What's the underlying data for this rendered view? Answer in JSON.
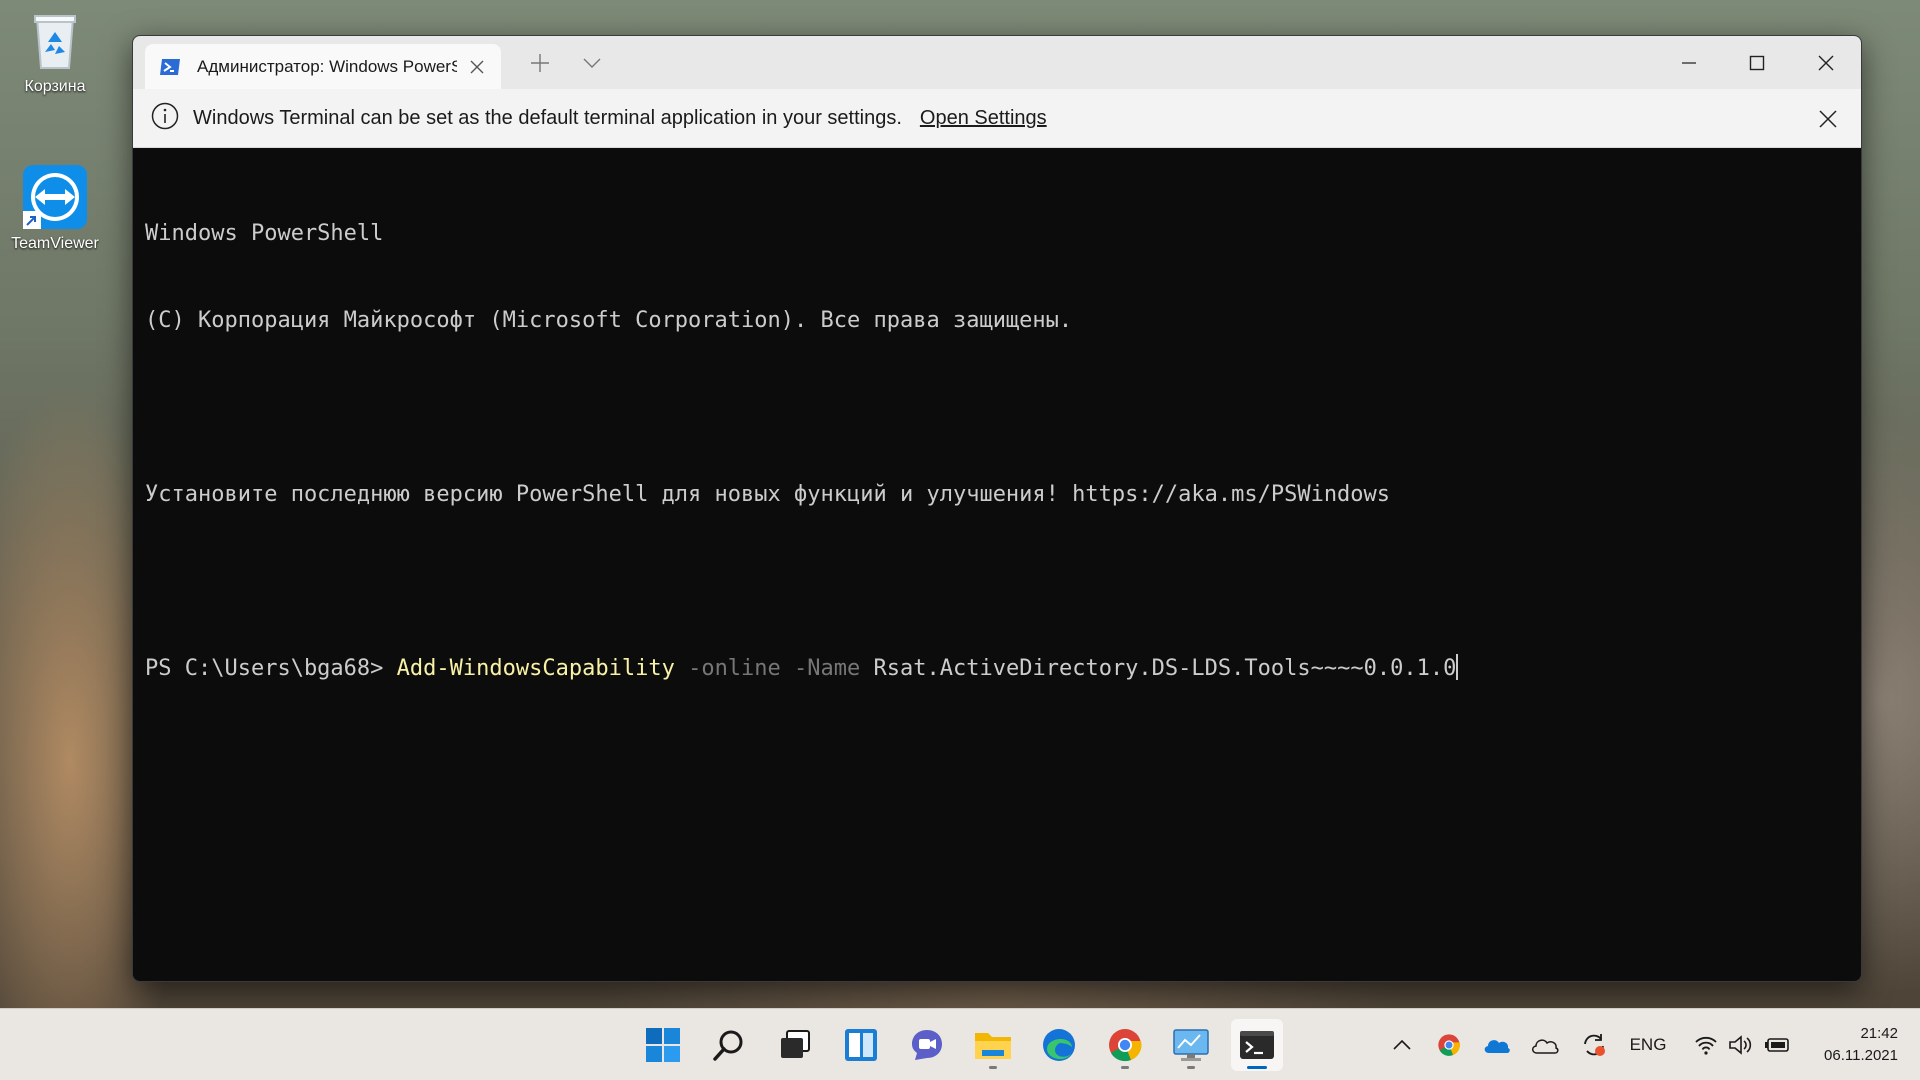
{
  "desktop": {
    "icons": [
      {
        "label": "Корзина",
        "icon": "recycle-bin-icon"
      },
      {
        "label": "TeamViewer",
        "icon": "teamviewer-icon"
      }
    ]
  },
  "window": {
    "tab_title": "Администратор: Windows PowerShell",
    "tab_icon": "powershell-icon",
    "new_tab_icon": "plus-icon",
    "dropdown_icon": "chevron-down-icon"
  },
  "infobar": {
    "message": "Windows Terminal can be set as the default terminal application in your settings.",
    "link_label": "Open Settings"
  },
  "console": {
    "line1": "Windows PowerShell",
    "line2": "(C) Корпорация Майкрософт (Microsoft Corporation). Все права защищены.",
    "line3": "Установите последнюю версию PowerShell для новых функций и улучшения! https://aka.ms/PSWindows",
    "prompt": "PS C:\\Users\\bga68> ",
    "command": "Add-WindowsCapability",
    "param1": " -online",
    "param2": " -Name",
    "argument": " Rsat.ActiveDirectory.DS-LDS.Tools~~~~0.0.1.0"
  },
  "taskbar": {
    "apps": [
      "start",
      "search",
      "task-view",
      "widgets",
      "chat",
      "file-explorer",
      "edge",
      "chrome",
      "control-panel",
      "terminal"
    ],
    "tray": {
      "language": "ENG",
      "time": "21:42",
      "date": "06.11.2021"
    }
  },
  "colors": {
    "console_bg": "#0c0c0c",
    "console_text": "#cccccc",
    "command": "#f9f1a5",
    "parameter": "#767676",
    "accent": "#0067c0"
  }
}
